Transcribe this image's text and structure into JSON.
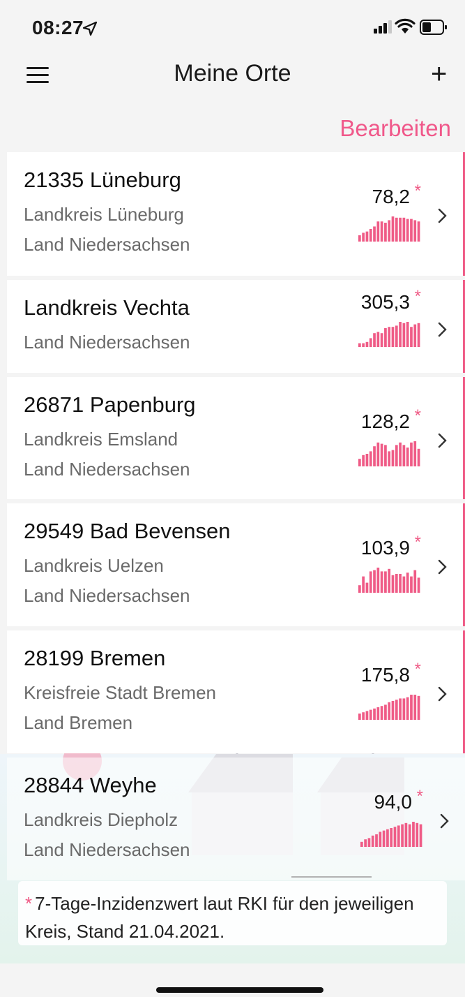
{
  "status": {
    "time": "08:27",
    "icons": [
      "location-arrow-icon",
      "cellular-signal-icon",
      "wifi-icon",
      "battery-icon"
    ]
  },
  "nav": {
    "title": "Meine Orte",
    "menu_icon": "hamburger-menu-icon",
    "add_icon": "+"
  },
  "edit_label": "Bearbeiten",
  "colors": {
    "accent": "#ef5b86",
    "text": "#1a1a1a",
    "subtle": "#6a6a6a"
  },
  "places": [
    {
      "title": "21335 Lüneburg",
      "lines": [
        "Landkreis Lüneburg",
        "Land Niedersachsen"
      ],
      "value": "78,2",
      "star": "*",
      "trend": [
        0.25,
        0.35,
        0.4,
        0.5,
        0.6,
        0.8,
        0.8,
        0.75,
        0.85,
        1.0,
        0.95,
        0.95,
        0.95,
        0.9,
        0.9,
        0.85,
        0.8
      ]
    },
    {
      "title": "Landkreis Vechta",
      "lines": [
        "Land Niedersachsen"
      ],
      "value": "305,3",
      "star": "*",
      "trend": [
        0.15,
        0.15,
        0.2,
        0.35,
        0.55,
        0.6,
        0.55,
        0.75,
        0.8,
        0.8,
        0.85,
        1.0,
        0.95,
        1.0,
        0.8,
        0.9,
        0.95
      ]
    },
    {
      "title": "26871 Papenburg",
      "lines": [
        "Landkreis Emsland",
        "Land Niedersachsen"
      ],
      "value": "128,2",
      "star": "*",
      "trend": [
        0.3,
        0.45,
        0.5,
        0.6,
        0.8,
        0.95,
        0.9,
        0.85,
        0.6,
        0.65,
        0.85,
        0.95,
        0.85,
        0.75,
        0.95,
        1.0,
        0.7
      ]
    },
    {
      "title": "29549 Bad Bevensen",
      "lines": [
        "Landkreis Uelzen",
        "Land Niedersachsen"
      ],
      "value": "103,9",
      "star": "*",
      "trend": [
        0.3,
        0.65,
        0.4,
        0.85,
        0.9,
        1.0,
        0.85,
        0.85,
        0.95,
        0.7,
        0.75,
        0.75,
        0.65,
        0.8,
        0.65,
        0.9,
        0.6
      ]
    },
    {
      "title": "28199 Bremen",
      "lines": [
        "Kreisfreie Stadt Bremen",
        "Land Bremen"
      ],
      "value": "175,8",
      "star": "*",
      "trend": [
        0.25,
        0.3,
        0.35,
        0.4,
        0.45,
        0.5,
        0.55,
        0.6,
        0.7,
        0.75,
        0.8,
        0.85,
        0.85,
        0.9,
        1.0,
        1.0,
        0.95
      ]
    },
    {
      "title": "28844 Weyhe",
      "lines": [
        "Landkreis Diepholz",
        "Land Niedersachsen"
      ],
      "value": "94,0",
      "star": "*",
      "trend": [
        0.2,
        0.3,
        0.35,
        0.45,
        0.5,
        0.6,
        0.65,
        0.7,
        0.75,
        0.8,
        0.85,
        0.9,
        0.95,
        0.9,
        1.0,
        0.95,
        0.9
      ]
    }
  ],
  "footnote": {
    "star": "*",
    "line1": "7-Tage-Inzidenzwert laut RKI für den jeweiligen",
    "line2": "Kreis, Stand 21.04.2021."
  }
}
